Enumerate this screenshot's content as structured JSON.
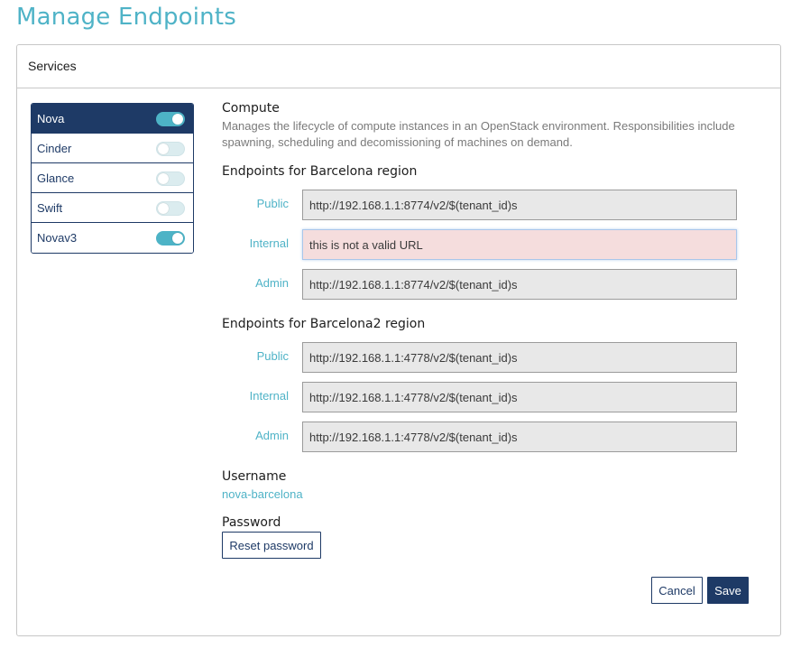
{
  "page": {
    "title": "Manage Endpoints"
  },
  "panel": {
    "header": "Services"
  },
  "services": [
    {
      "label": "Nova",
      "enabled": true,
      "active": true
    },
    {
      "label": "Cinder",
      "enabled": false,
      "active": false
    },
    {
      "label": "Glance",
      "enabled": false,
      "active": false
    },
    {
      "label": "Swift",
      "enabled": false,
      "active": false
    },
    {
      "label": "Novav3",
      "enabled": true,
      "active": false
    }
  ],
  "detail": {
    "name": "Compute",
    "description": "Manages the lifecycle of compute instances in an OpenStack environment. Responsibilities include spawning, scheduling and decomissioning of machines on demand.",
    "regions": [
      {
        "title": "Endpoints for Barcelona region",
        "endpoints": [
          {
            "label": "Public",
            "value": "http://192.168.1.1:8774/v2/$(tenant_id)s",
            "invalid": false
          },
          {
            "label": "Internal",
            "value": "this is not a valid URL",
            "invalid": true
          },
          {
            "label": "Admin",
            "value": "http://192.168.1.1:8774/v2/$(tenant_id)s",
            "invalid": false
          }
        ]
      },
      {
        "title": "Endpoints for Barcelona2 region",
        "endpoints": [
          {
            "label": "Public",
            "value": "http://192.168.1.1:4778/v2/$(tenant_id)s",
            "invalid": false
          },
          {
            "label": "Internal",
            "value": "http://192.168.1.1:4778/v2/$(tenant_id)s",
            "invalid": false
          },
          {
            "label": "Admin",
            "value": "http://192.168.1.1:4778/v2/$(tenant_id)s",
            "invalid": false
          }
        ]
      }
    ],
    "username_label": "Username",
    "username_value": "nova-barcelona",
    "password_label": "Password",
    "reset_password_label": "Reset password"
  },
  "actions": {
    "cancel_label": "Cancel",
    "save_label": "Save"
  },
  "colors": {
    "accent": "#4fb3c7",
    "primary": "#1e3a66",
    "invalid_bg": "#f5dddd"
  }
}
